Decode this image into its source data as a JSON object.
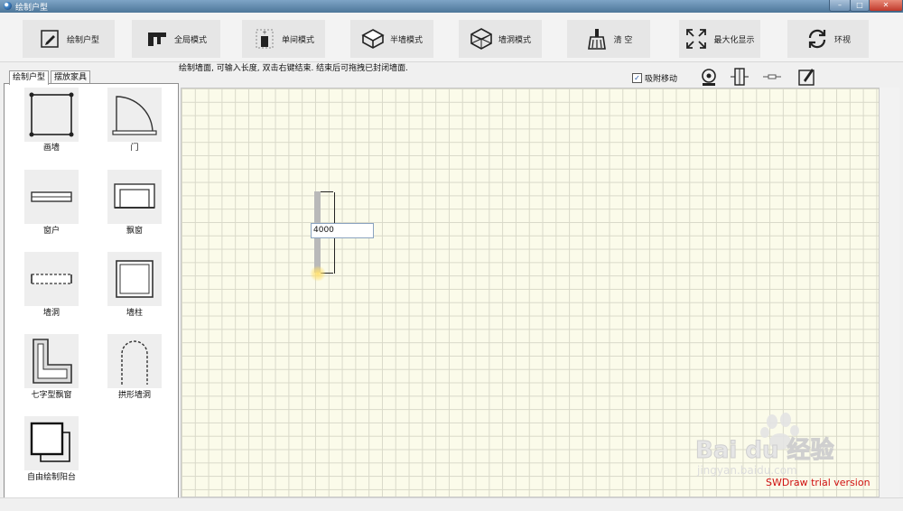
{
  "window": {
    "title": "绘制户型",
    "controls": {
      "min": "–",
      "max": "□",
      "close": "✕"
    }
  },
  "toolbar": {
    "buttons": [
      {
        "label": "绘制户型",
        "icon": "pencil-icon"
      },
      {
        "label": "全局模式",
        "icon": "global-mode-icon"
      },
      {
        "label": "单间模式",
        "icon": "single-room-icon"
      },
      {
        "label": "半墙模式",
        "icon": "half-wall-icon"
      },
      {
        "label": "墙洞模式",
        "icon": "wall-hole-icon"
      },
      {
        "label": "清 空",
        "icon": "broom-icon"
      },
      {
        "label": "最大化显示",
        "icon": "maximize-icon"
      },
      {
        "label": "环视",
        "icon": "rotate-icon"
      }
    ]
  },
  "hint": "绘制墙面, 可输入长度, 双击右键结束.   结束后可拖拽已封闭墙面.",
  "snap": {
    "label": "吸附移动",
    "checked": true
  },
  "tabs": [
    {
      "label": "绘制户型",
      "active": true
    },
    {
      "label": "摆放家具",
      "active": false
    }
  ],
  "panel_items": [
    {
      "label": "画墙",
      "icon": "draw-wall-icon"
    },
    {
      "label": "门",
      "icon": "door-icon"
    },
    {
      "label": "窗户",
      "icon": "window-icon"
    },
    {
      "label": "飘窗",
      "icon": "bay-window-icon"
    },
    {
      "label": "墙洞",
      "icon": "wall-opening-icon"
    },
    {
      "label": "墙柱",
      "icon": "pillar-icon"
    },
    {
      "label": "七字型飘窗",
      "icon": "l-bay-window-icon"
    },
    {
      "label": "拱形墙洞",
      "icon": "arch-opening-icon"
    },
    {
      "label": "自由绘制阳台",
      "icon": "free-balcony-icon"
    }
  ],
  "canvas": {
    "length_input": "4000",
    "trial_text": "SWDraw trial version"
  },
  "watermark": {
    "text": "Bai du 经验",
    "sub": "jingyan.baidu.com"
  },
  "colors": {
    "grid_bg": "#fbfbea",
    "grid_line": "#d9d9c9",
    "trial": "#d01010"
  }
}
